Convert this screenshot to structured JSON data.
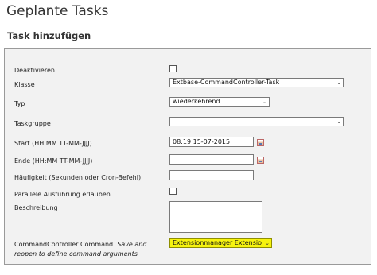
{
  "page": {
    "title": "Geplante Tasks",
    "section_title": "Task hinzufügen"
  },
  "form": {
    "deaktivieren": {
      "label": "Deaktivieren",
      "checked": false
    },
    "klasse": {
      "label": "Klasse",
      "value": "Extbase-CommandController-Task"
    },
    "typ": {
      "label": "Typ",
      "value": "wiederkehrend"
    },
    "taskgruppe": {
      "label": "Taskgruppe",
      "value": ""
    },
    "start": {
      "label": "Start (HH:MM TT-MM-JJJJ)",
      "value": "08:19 15-07-2015"
    },
    "ende": {
      "label": "Ende (HH:MM TT-MM-JJJJ)",
      "value": ""
    },
    "haeufigkeit": {
      "label": "Häufigkeit (Sekunden oder Cron-Befehl)",
      "value": ""
    },
    "parallel": {
      "label": "Parallele Ausführung erlauben",
      "checked": false
    },
    "beschreibung": {
      "label": "Beschreibung",
      "value": ""
    },
    "command": {
      "label": "CommandController Command.",
      "hint": "Save and reopen to define command arguments",
      "value": "Extensionmanager Extensio",
      "highlight_color": "#f6f30f"
    }
  },
  "icons": {
    "calendar": "calendar-icon",
    "dropdown": "chevron-down-icon"
  }
}
